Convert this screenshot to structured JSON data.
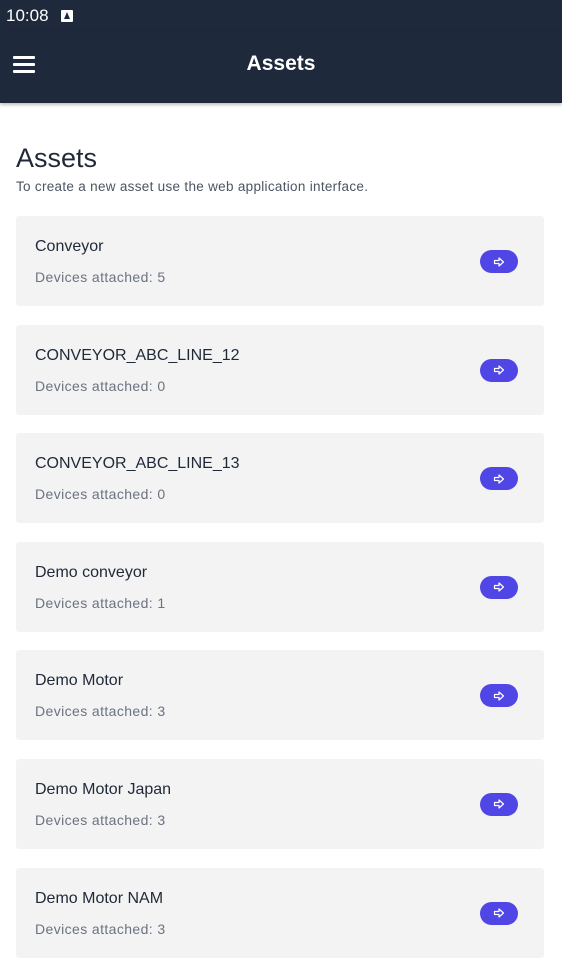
{
  "status_bar": {
    "time": "10:08",
    "notification_icon": "notification-a-icon"
  },
  "app_bar": {
    "title": "Assets",
    "menu_icon": "menu-icon"
  },
  "page": {
    "title": "Assets",
    "subtitle": "To create a new asset use the web application interface."
  },
  "assets": [
    {
      "name": "Conveyor",
      "devices": "Devices attached: 5"
    },
    {
      "name": "CONVEYOR_ABC_LINE_12",
      "devices": "Devices attached: 0"
    },
    {
      "name": "CONVEYOR_ABC_LINE_13",
      "devices": "Devices attached: 0"
    },
    {
      "name": "Demo conveyor",
      "devices": "Devices attached: 1"
    },
    {
      "name": "Demo Motor",
      "devices": "Devices attached: 3"
    },
    {
      "name": "Demo Motor Japan",
      "devices": "Devices attached: 3"
    },
    {
      "name": "Demo Motor NAM",
      "devices": "Devices attached: 3"
    }
  ],
  "colors": {
    "app_bar": "#1e293b",
    "accent": "#4f46e5",
    "card_bg": "#f3f3f3"
  },
  "open_button_icon": "arrow-right-icon"
}
